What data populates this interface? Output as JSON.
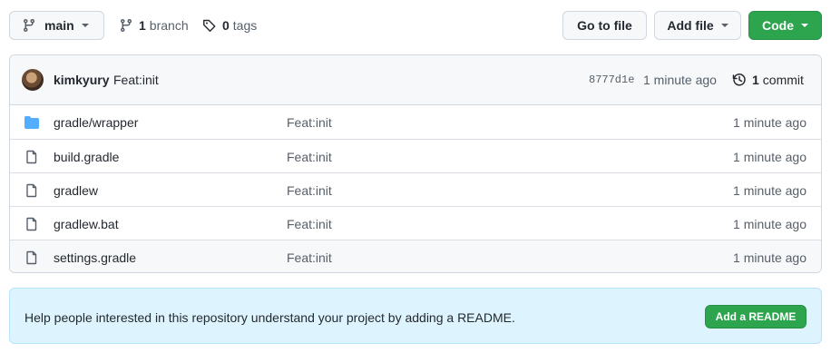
{
  "toolbar": {
    "branch_button": {
      "label": "main",
      "icon": "git-branch-icon"
    },
    "branch_count": {
      "number": "1",
      "label": "branch",
      "icon": "git-branch-icon"
    },
    "tag_count": {
      "number": "0",
      "label": "tags",
      "icon": "tag-icon"
    },
    "go_to_file_label": "Go to file",
    "add_file_label": "Add file",
    "code_label": "Code"
  },
  "latest_commit": {
    "author": "kimkyury",
    "message": "Feat:init",
    "sha": "8777d1e",
    "time": "1 minute ago",
    "commit_count": "1",
    "commit_label": "commit",
    "history_icon": "history-icon"
  },
  "files": [
    {
      "name": "gradle/wrapper",
      "type": "directory",
      "icon": "folder-icon",
      "message": "Feat:init",
      "time": "1 minute ago"
    },
    {
      "name": "build.gradle",
      "type": "file",
      "icon": "file-icon",
      "message": "Feat:init",
      "time": "1 minute ago"
    },
    {
      "name": "gradlew",
      "type": "file",
      "icon": "file-icon",
      "message": "Feat:init",
      "time": "1 minute ago"
    },
    {
      "name": "gradlew.bat",
      "type": "file",
      "icon": "file-icon",
      "message": "Feat:init",
      "time": "1 minute ago"
    },
    {
      "name": "settings.gradle",
      "type": "file",
      "icon": "file-icon",
      "message": "Feat:init",
      "time": "1 minute ago"
    }
  ],
  "readme_banner": {
    "text": "Help people interested in this repository understand your project by adding a README.",
    "button_label": "Add a README"
  },
  "colors": {
    "primary_green": "#2da44e",
    "folder_blue": "#54aeff",
    "banner_bg": "#ddf4ff"
  }
}
